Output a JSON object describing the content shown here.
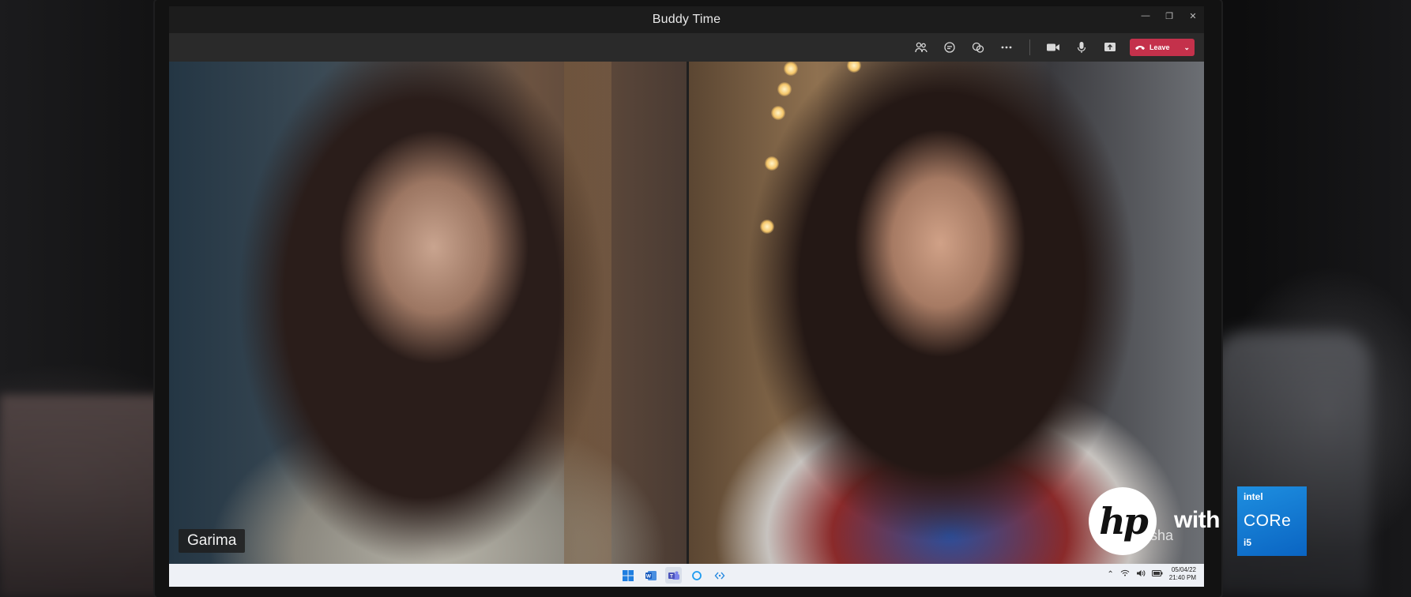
{
  "window": {
    "title": "Buddy Time",
    "controls": [
      "minimize",
      "restore",
      "close"
    ]
  },
  "toolbar": {
    "icons": [
      "participants-icon",
      "chat-icon",
      "reactions-icon",
      "more-icon",
      "camera-icon",
      "mic-icon",
      "share-icon"
    ],
    "leave_label": "Leave",
    "leave_color": "#c4314b"
  },
  "participants": [
    {
      "name": "Garima"
    },
    {
      "name": "Aisha"
    }
  ],
  "taskbar": {
    "apps": [
      "windows-start-icon",
      "word-icon",
      "teams-icon",
      "cortana-icon",
      "kx-icon"
    ],
    "date": "05/04/22",
    "time": "21:40 PM"
  },
  "branding": {
    "hp_logo": "hp",
    "with_text": "with",
    "intel_brand": "intel",
    "intel_core": "CORe",
    "intel_tier": "i5"
  }
}
